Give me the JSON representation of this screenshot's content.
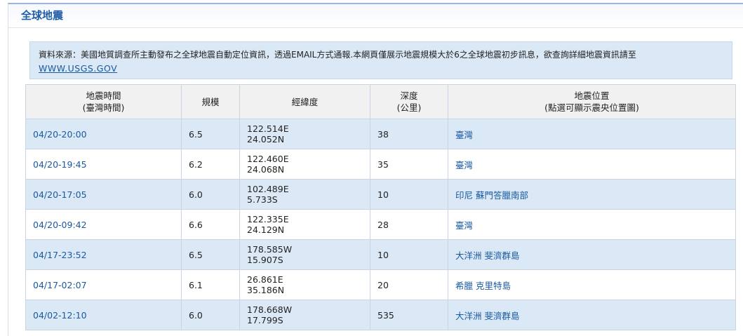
{
  "panel": {
    "title": "全球地震"
  },
  "notice": {
    "text": "資料來源：美國地質調查所主動發布之全球地震自動定位資訊，透過EMAIL方式通報.本網頁僅展示地震規模大於6之全球地震初步訊息，欲查詢詳細地震資訊請至",
    "link": "WWW.USGS.GOV"
  },
  "table": {
    "headers": {
      "time_line1": "地震時間",
      "time_line2": "(臺灣時間)",
      "mag": "規模",
      "coord": "經緯度",
      "depth_line1": "深度",
      "depth_line2": "(公里)",
      "loc_line1": "地震位置",
      "loc_line2": "(點選可顯示震央位置圖)"
    },
    "rows": [
      {
        "time": "04/20-20:00",
        "mag": "6.5",
        "lon": "122.514E",
        "lat": "24.052N",
        "depth": "38",
        "loc": "臺灣"
      },
      {
        "time": "04/20-19:45",
        "mag": "6.2",
        "lon": "122.460E",
        "lat": "24.068N",
        "depth": "35",
        "loc": "臺灣"
      },
      {
        "time": "04/20-17:05",
        "mag": "6.0",
        "lon": "102.489E",
        "lat": "5.733S",
        "depth": "10",
        "loc": "印尼 蘇門答臘南部"
      },
      {
        "time": "04/20-09:42",
        "mag": "6.6",
        "lon": "122.335E",
        "lat": "24.129N",
        "depth": "28",
        "loc": "臺灣"
      },
      {
        "time": "04/17-23:52",
        "mag": "6.5",
        "lon": "178.585W",
        "lat": "15.907S",
        "depth": "10",
        "loc": "大洋洲 斐濟群島"
      },
      {
        "time": "04/17-02:07",
        "mag": "6.1",
        "lon": "26.861E",
        "lat": "35.186N",
        "depth": "20",
        "loc": "希臘 克里特島"
      },
      {
        "time": "04/02-12:10",
        "mag": "6.0",
        "lon": "178.668W",
        "lat": "17.799S",
        "depth": "535",
        "loc": "大洋洲 斐濟群島"
      }
    ]
  }
}
